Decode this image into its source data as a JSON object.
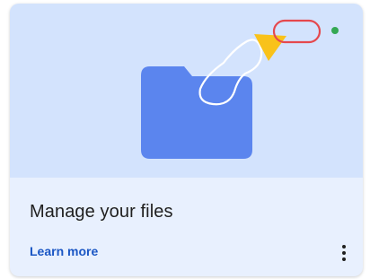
{
  "card": {
    "title": "Manage your files",
    "link_label": "Learn more",
    "menu_icon": "more-vert-icon",
    "illustration": "folder-icon"
  },
  "colors": {
    "hero_background": "#d3e3fd",
    "card_background": "#e8f0fe",
    "folder": "#5b85ee",
    "triangle": "#f9c21a",
    "oval_outline": "#e5484d",
    "dot": "#34a853",
    "link": "#1a56c4"
  }
}
